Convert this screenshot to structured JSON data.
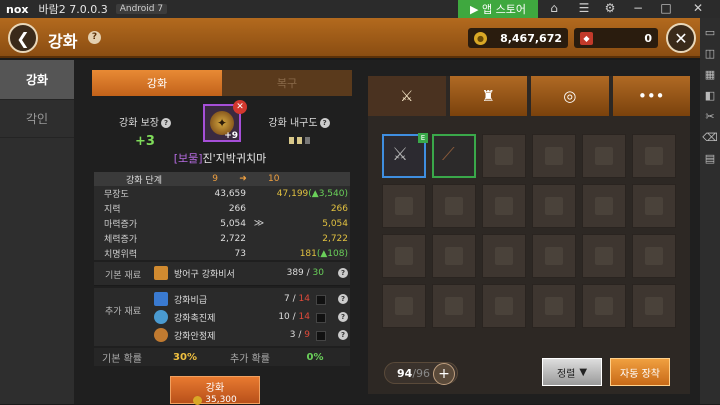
{
  "emulator": {
    "logo": "nox",
    "app_title": "바람2 7.0.0.3",
    "android_label": "Android 7",
    "store_label": "앱 스토어",
    "icons": [
      "shirt-icon",
      "folder-icon",
      "gear-icon",
      "minimize-icon",
      "maximize-icon",
      "close-icon"
    ]
  },
  "header": {
    "title": "강화",
    "gold": "8,467,672",
    "gems": "0"
  },
  "sidebar": {
    "items": [
      {
        "label": "강화",
        "active": true
      },
      {
        "label": "각인",
        "active": false
      }
    ]
  },
  "tabs": {
    "enhance": "강화",
    "restore": "복구"
  },
  "item": {
    "guard_label": "강화 보장",
    "guard_value": "+3",
    "plus": "+9",
    "grade_tag": "[보물]",
    "name": "진'지박귀치마",
    "durability_label": "강화 내구도"
  },
  "stats": {
    "level_label": "강화 단계",
    "level_from": "9",
    "level_to": "10",
    "rows": [
      {
        "name": "무장도",
        "before": "43,659",
        "after": "47,199",
        "gain": "(▲3,540)"
      },
      {
        "name": "지력",
        "before": "266",
        "after": "266",
        "gain": ""
      },
      {
        "name": "마력증가",
        "before": "5,054",
        "after": "5,054",
        "gain": ""
      },
      {
        "name": "체력증가",
        "before": "2,722",
        "after": "2,722",
        "gain": ""
      },
      {
        "name": "치명위력",
        "before": "73",
        "after": "181",
        "gain": "(▲108)"
      }
    ]
  },
  "materials": {
    "base_label": "기본 재료",
    "base_item": "방어구 강화비서",
    "base_have": "389",
    "base_need": "30",
    "extra_label": "추가 재료",
    "extra": [
      {
        "name": "강화비급",
        "have": "7",
        "need": "14"
      },
      {
        "name": "강화촉진제",
        "have": "10",
        "need": "14"
      },
      {
        "name": "강화안정제",
        "have": "3",
        "need": "9"
      }
    ]
  },
  "rates": {
    "base_label": "기본 확률",
    "base_value": "30%",
    "extra_label": "추가 확률",
    "extra_value": "0%"
  },
  "enhance_button": {
    "label": "강화",
    "cost": "35,300"
  },
  "inventory": {
    "categories": [
      "weapon-icon",
      "armor-icon",
      "ring-icon",
      "more-icon"
    ],
    "count": "94",
    "capacity": "96",
    "sort_label": "정렬",
    "auto_equip_label": "자동 장착"
  }
}
